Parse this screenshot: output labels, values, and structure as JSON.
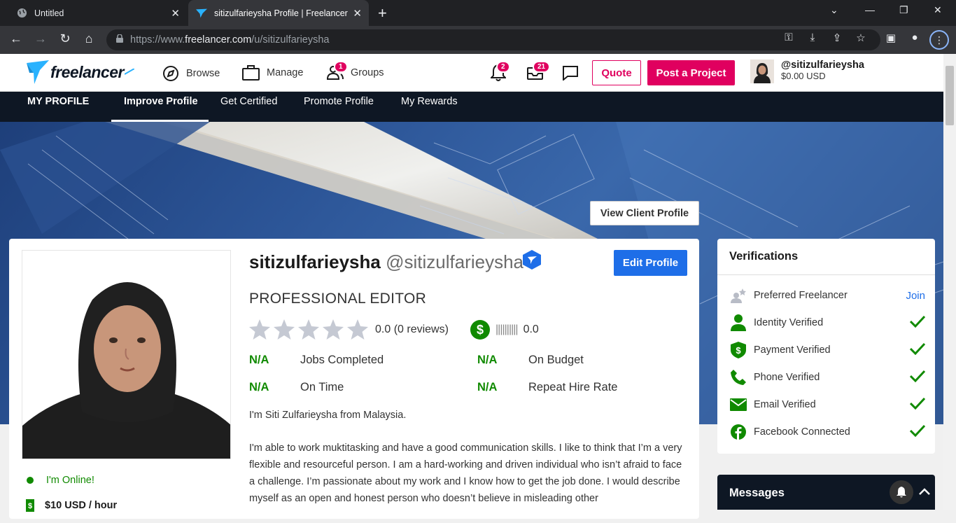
{
  "browser": {
    "tabs": [
      {
        "title": "Untitled"
      },
      {
        "title": "sitizulfarieysha Profile | Freelancer"
      }
    ],
    "url": {
      "prefix": "https://www.",
      "host": "freelancer.com",
      "path": "/u/sitizulfarieysha"
    }
  },
  "header": {
    "logo_text": "freelancer",
    "nav": [
      {
        "label": "Browse",
        "icon": "compass-icon"
      },
      {
        "label": "Manage",
        "icon": "briefcase-icon"
      },
      {
        "label": "Groups",
        "icon": "users-icon",
        "badge": "1"
      }
    ],
    "notifications_count": "2",
    "inbox_count": "21",
    "quote_label": "Quote",
    "post_project_label": "Post a Project",
    "user": {
      "handle": "@sitizulfarieysha",
      "balance": "$0.00 USD"
    }
  },
  "profile_nav": {
    "items": [
      "MY PROFILE",
      "Improve Profile",
      "Get Certified",
      "Promote Profile",
      "My Rewards"
    ],
    "active": "Improve Profile"
  },
  "banner": {
    "view_client_profile": "View Client Profile"
  },
  "profile": {
    "name": "sitizulfarieysha",
    "handle": "@sitizulfarieysha",
    "edit_label": "Edit Profile",
    "title": "PROFESSIONAL EDITOR",
    "rating_text": "0.0 (0 reviews)",
    "rating_value": 0,
    "earnings_bars": "||||||||||",
    "earnings_score": "0.0",
    "stats": [
      {
        "value": "N/A",
        "label": "Jobs Completed"
      },
      {
        "value": "N/A",
        "label": "On Budget"
      },
      {
        "value": "N/A",
        "label": "On Time"
      },
      {
        "value": "N/A",
        "label": "Repeat Hire Rate"
      }
    ],
    "online_status": "I'm Online!",
    "hourly_rate": "$10 USD / hour",
    "bio": [
      "I'm Siti Zulfarieysha from Malaysia.",
      "I'm able to work muktitasking and have a good communication skills. I like to think that I’m a very flexible and resourceful person. I am a hard-working and driven individual who isn’t afraid to face a challenge. I’m passionate about my work and I know how to get the job done. I would describe myself as an open and honest person who doesn’t believe in misleading other"
    ]
  },
  "verifications": {
    "title": "Verifications",
    "items": [
      {
        "label": "Preferred Freelancer",
        "action": "Join",
        "icon": "preferred-freelancer-icon"
      },
      {
        "label": "Identity Verified",
        "icon": "person-icon"
      },
      {
        "label": "Payment Verified",
        "icon": "payment-shield-icon"
      },
      {
        "label": "Phone Verified",
        "icon": "phone-icon"
      },
      {
        "label": "Email Verified",
        "icon": "email-icon"
      },
      {
        "label": "Facebook Connected",
        "icon": "facebook-icon"
      }
    ]
  },
  "messages": {
    "title": "Messages"
  },
  "colors": {
    "brand_pink": "#e0005f",
    "brand_blue": "#1e6ee8",
    "success_green": "#108a00",
    "navy": "#0e1724"
  }
}
